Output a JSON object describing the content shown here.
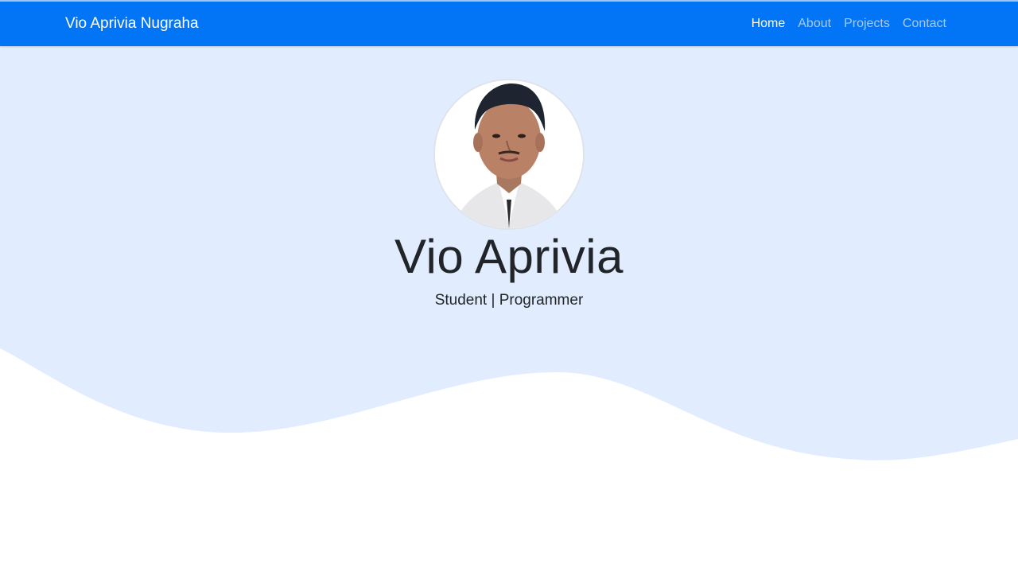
{
  "navbar": {
    "brand": "Vio Aprivia Nugraha",
    "links": [
      {
        "label": "Home",
        "active": true
      },
      {
        "label": "About",
        "active": false
      },
      {
        "label": "Projects",
        "active": false
      },
      {
        "label": "Contact",
        "active": false
      }
    ]
  },
  "hero": {
    "title": "Vio Aprivia",
    "subtitle": "Student | Programmer",
    "avatar_icon": "profile-photo"
  },
  "colors": {
    "navbar_bg": "#0275f6",
    "hero_bg": "#e1edfe",
    "text": "#212529",
    "nav_link_active": "#ffffff",
    "nav_link_inactive": "#a9c9ee"
  }
}
